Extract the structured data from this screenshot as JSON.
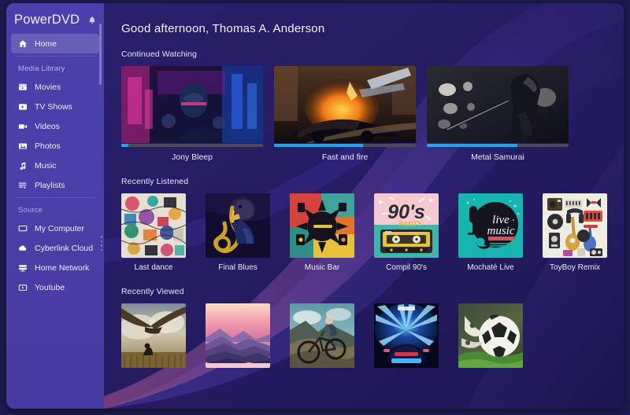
{
  "app": {
    "title": "PowerDVD",
    "accent_color": "#4a3fa8",
    "content_bg": "#251c63",
    "progress_color": "#23a3ec",
    "notification_icon": "bell-icon"
  },
  "sidebar": {
    "home": {
      "label": "Home",
      "icon": "home-icon",
      "active": true
    },
    "sections": [
      {
        "heading": "Media Library",
        "items": [
          {
            "label": "Movies",
            "icon": "movie-clapper-icon"
          },
          {
            "label": "TV Shows",
            "icon": "tv-icon"
          },
          {
            "label": "Videos",
            "icon": "video-camera-icon"
          },
          {
            "label": "Photos",
            "icon": "photo-icon"
          },
          {
            "label": "Music",
            "icon": "music-note-icon"
          },
          {
            "label": "Playlists",
            "icon": "playlist-icon"
          }
        ]
      },
      {
        "heading": "Source",
        "items": [
          {
            "label": "My Computer",
            "icon": "monitor-icon"
          },
          {
            "label": "Cyberlink Cloud",
            "icon": "cloud-icon"
          },
          {
            "label": "Home Network",
            "icon": "network-server-icon"
          },
          {
            "label": "Youtube",
            "icon": "youtube-play-icon"
          }
        ]
      }
    ],
    "resize_handle": "sidebar-resize-handle",
    "scrollbar": "sidebar-scrollbar"
  },
  "main": {
    "greeting": "Good afternoon, Thomas A. Anderson",
    "sections": [
      {
        "id": "continued-watching",
        "title": "Continued Watching",
        "items": [
          {
            "label": "Jony Bleep",
            "progress": 5,
            "art": "neon-cyberpunk-man"
          },
          {
            "label": "Fast and fire",
            "progress": 63,
            "art": "burning-car-chase"
          },
          {
            "label": "Metal Samurai",
            "progress": 64,
            "art": "katana-warrior-bokeh"
          }
        ]
      },
      {
        "id": "recently-listened",
        "title": "Recently Listened",
        "items": [
          {
            "label": "Last dance",
            "art": "doodle-collage"
          },
          {
            "label": "Final Blues",
            "art": "saxophone-player"
          },
          {
            "label": "Music Bar",
            "art": "retro-sunburst-instruments"
          },
          {
            "label": "Compil 90's",
            "art": "cassette-tape-90s"
          },
          {
            "label": "Mochaté Live",
            "art": "live-music-teal"
          },
          {
            "label": "ToyBoy Remix",
            "art": "music-gear-flatlay"
          }
        ]
      },
      {
        "id": "recently-viewed",
        "title": "Recently Viewed",
        "items": [
          {
            "label": "",
            "art": "dragon-and-child"
          },
          {
            "label": "",
            "art": "pink-mountain-sunset"
          },
          {
            "label": "",
            "art": "mountain-biker"
          },
          {
            "label": "",
            "art": "blue-tunnel-car"
          },
          {
            "label": "",
            "art": "soccer-ball-grass"
          }
        ]
      }
    ]
  }
}
